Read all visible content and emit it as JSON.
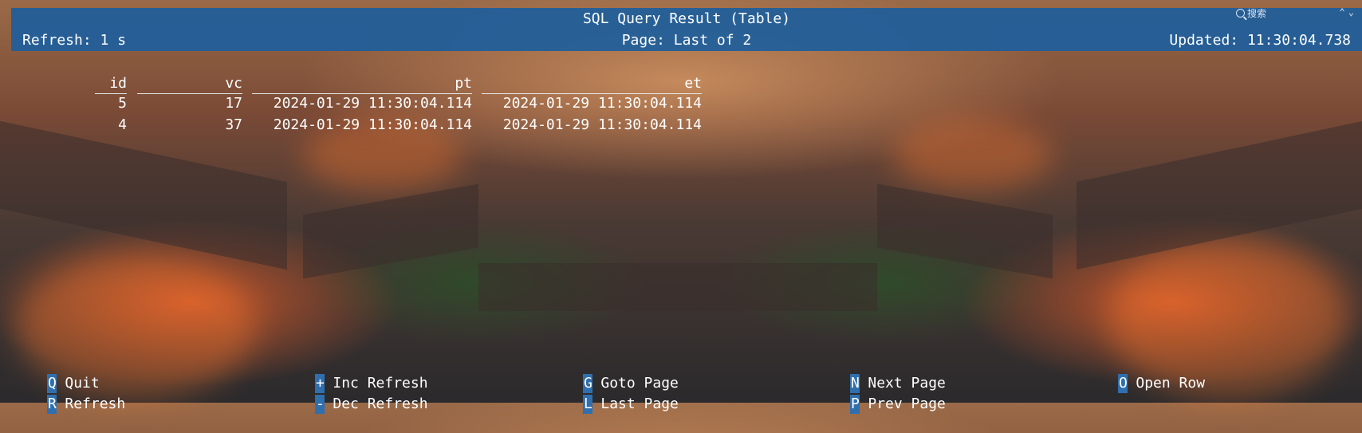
{
  "window": {
    "title": "SQL Query Result (Table)",
    "search_label": "搜索"
  },
  "status": {
    "refresh": "Refresh: 1 s",
    "page": "Page: Last of 2",
    "updated": "Updated: 11:30:04.738"
  },
  "table": {
    "columns": [
      "id",
      "vc",
      "pt",
      "et"
    ],
    "rows": [
      [
        "5",
        "17",
        "2024-01-29 11:30:04.114",
        "2024-01-29 11:30:04.114"
      ],
      [
        "4",
        "37",
        "2024-01-29 11:30:04.114",
        "2024-01-29 11:30:04.114"
      ]
    ]
  },
  "commands": [
    {
      "key": "Q",
      "label": "Quit"
    },
    {
      "key": "R",
      "label": "Refresh"
    },
    {
      "key": "+",
      "label": "Inc Refresh"
    },
    {
      "key": "-",
      "label": "Dec Refresh"
    },
    {
      "key": "G",
      "label": "Goto Page"
    },
    {
      "key": "L",
      "label": "Last Page"
    },
    {
      "key": "N",
      "label": "Next Page"
    },
    {
      "key": "P",
      "label": "Prev Page"
    },
    {
      "key": "O",
      "label": "Open Row"
    }
  ],
  "colors": {
    "titlebar": "#1d5e9c",
    "key_highlight": "#2f6fae",
    "text": "#ffffff"
  },
  "icons": {
    "search": "search-icon",
    "arrows": "chevron-up-down-icon"
  }
}
